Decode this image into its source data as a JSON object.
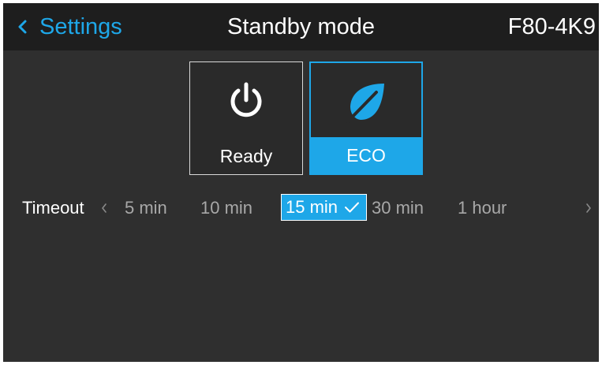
{
  "header": {
    "back_label": "Settings",
    "title": "Standby mode",
    "device_name": "F80-4K9"
  },
  "modes": [
    {
      "label": "Ready",
      "icon": "power-icon",
      "selected": false
    },
    {
      "label": "ECO",
      "icon": "leaf-icon",
      "selected": true
    }
  ],
  "timeout": {
    "label": "Timeout",
    "options": [
      "5 min",
      "10 min",
      "15 min",
      "30 min",
      "1 hour"
    ],
    "selected": "15 min"
  },
  "colors": {
    "accent": "#1ea7e8",
    "header_bg": "#1e1e1e",
    "panel_bg": "#2f2f2f",
    "text": "#ffffff",
    "text_dim": "#a8a8a8"
  }
}
